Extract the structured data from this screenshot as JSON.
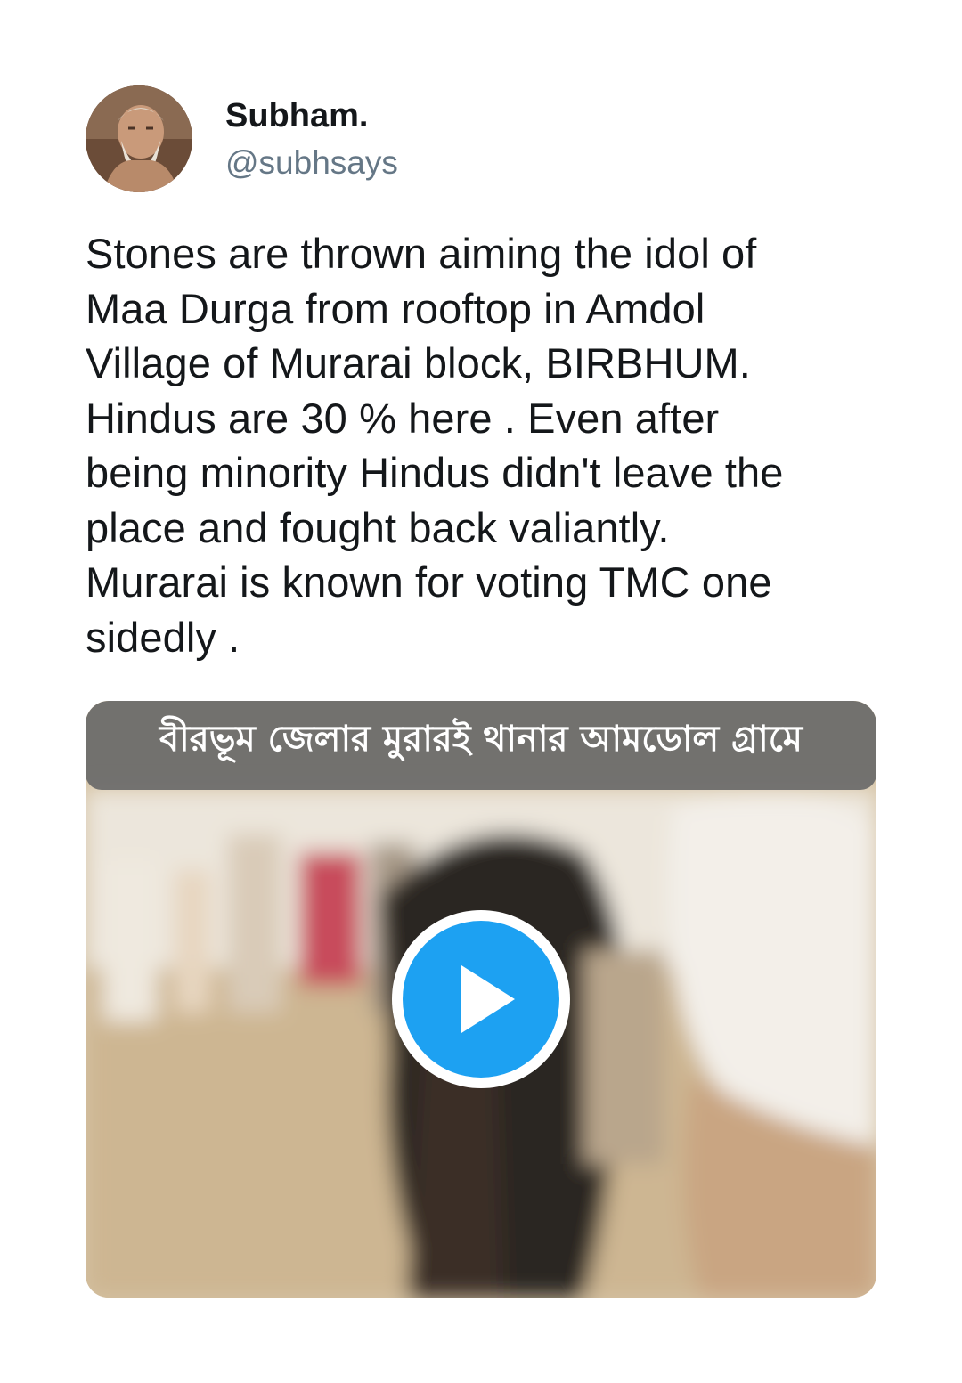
{
  "author": {
    "display_name": "Subham.",
    "handle": "@subhsays"
  },
  "tweet": {
    "text": "Stones are thrown aiming the idol of\nMaa Durga from rooftop in Amdol\nVillage of Murarai block, BIRBHUM.\nHindus are 30 % here . Even after\nbeing minority Hindus didn't leave the\nplace and fought back valiantly.\nMurarai is known for voting TMC one\nsidedly ."
  },
  "media": {
    "type": "video",
    "caption_overlay": "বীরভূম জেলার মুরারই থানার আমডোল গ্রামে",
    "play_icon": "play-icon",
    "play_color": "#1da1f2"
  }
}
